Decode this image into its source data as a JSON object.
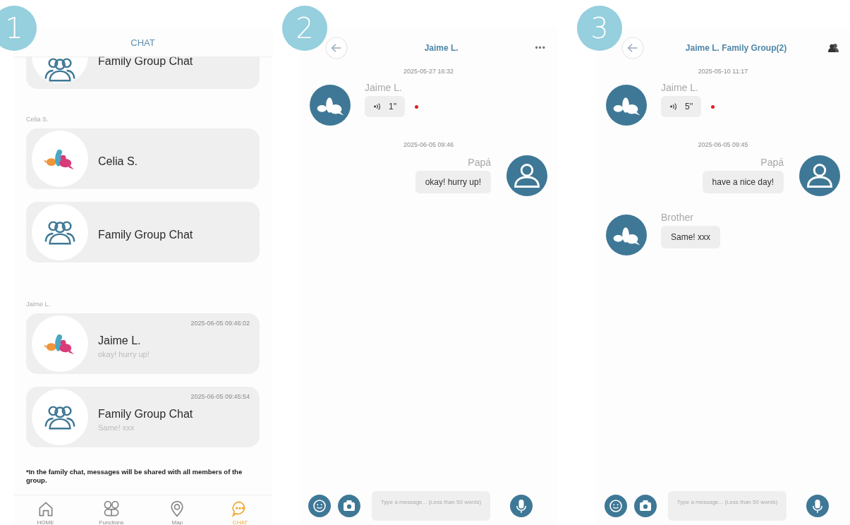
{
  "screens": [
    {
      "kind": "list",
      "badge": "1",
      "title": "CHAT",
      "partial_item": {
        "kind": "group",
        "name": "Family Group Chat"
      },
      "items": [
        {
          "kind": "section",
          "label": "Celia S."
        },
        {
          "kind": "contact",
          "name": "Celia S."
        },
        {
          "kind": "group",
          "name": "Family Group Chat"
        },
        {
          "kind": "section",
          "label": "Jaime L."
        },
        {
          "kind": "contact",
          "name": "Jaime L.",
          "preview": "okay! hurry up!",
          "time": "2025-06-05 09:46:02"
        },
        {
          "kind": "group",
          "name": "Family Group Chat",
          "preview": "Same! xxx",
          "time": "2025-06-05 09:45:54"
        }
      ],
      "note": "*In the family chat, messages will be shared with all members of the group.",
      "tabs": [
        {
          "kind": "home",
          "label": "HOME",
          "selected": false
        },
        {
          "kind": "functions",
          "label": "Functions",
          "selected": false
        },
        {
          "kind": "map",
          "label": "Map",
          "selected": false
        },
        {
          "kind": "chat",
          "label": "CHAT",
          "selected": true
        }
      ]
    },
    {
      "kind": "chat",
      "badge": "2",
      "title": "Jaime L.",
      "header_action": {
        "kind": "menu",
        "text": "•••"
      },
      "messages": [
        {
          "kind": "date",
          "text": "2025-05-27 16:32"
        },
        {
          "kind": "voice",
          "sender": "Jaime L.",
          "outgoing": false,
          "duration": "1''",
          "unread": true
        },
        {
          "kind": "date",
          "text": "2025-06-05 09:46"
        },
        {
          "kind": "text",
          "sender": "Papá",
          "outgoing": true,
          "text": "okay! hurry up!"
        }
      ],
      "composer": {
        "placeholder": "Type a message... (Less than 50 words)"
      }
    },
    {
      "kind": "chat",
      "badge": "3",
      "title": "Jaime L. Family Group(2)",
      "header_action": {
        "kind": "members"
      },
      "messages": [
        {
          "kind": "date",
          "text": "2025-05-10 11:17"
        },
        {
          "kind": "voice",
          "sender": "Jaime L.",
          "outgoing": false,
          "duration": "5''",
          "unread": true
        },
        {
          "kind": "date",
          "text": "2025-06-05 09:45"
        },
        {
          "kind": "text",
          "sender": "Papá",
          "outgoing": true,
          "text": "have a nice day!"
        },
        {
          "kind": "text",
          "sender": "Brother",
          "outgoing": false,
          "text": "Same! xxx"
        }
      ],
      "composer": {
        "placeholder": "Type a message... (Less than 50 words)"
      }
    }
  ]
}
